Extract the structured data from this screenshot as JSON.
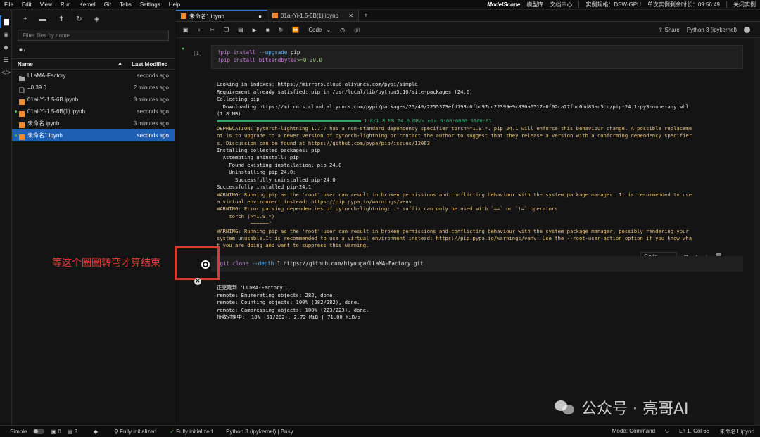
{
  "menu": [
    "File",
    "Edit",
    "View",
    "Run",
    "Kernel",
    "Git",
    "Tabs",
    "Settings",
    "Help"
  ],
  "topright": {
    "brand": "ModelScope",
    "links": [
      "模型库",
      "文档中心"
    ],
    "spec": "实例规格：DSW-GPU",
    "remaining": "单次实例剩余时长：09:56:49",
    "close": "关闭实例"
  },
  "filebrowser": {
    "filter_placeholder": "Filter files by name",
    "path": "■ /",
    "col_name": "Name",
    "col_modified": "Last Modified",
    "rows": [
      {
        "name": "LLaMA-Factory",
        "modified": "seconds ago",
        "icon": "folder-icon"
      },
      {
        "name": "=0.39.0",
        "modified": "2 minutes ago",
        "icon": "file-icon"
      },
      {
        "name": "01ai-Yi-1.5-6B.ipynb",
        "modified": "3 minutes ago",
        "icon": "notebook-icon"
      },
      {
        "name": "01ai-Yi-1.5-6B(1).ipynb",
        "modified": "seconds ago",
        "icon": "notebook-icon"
      },
      {
        "name": "未命名.ipynb",
        "modified": "3 minutes ago",
        "icon": "notebook-icon"
      },
      {
        "name": "未命名1.ipynb",
        "modified": "seconds ago",
        "icon": "notebook-icon"
      }
    ]
  },
  "tabs": [
    {
      "label": "未命名1.ipynb"
    },
    {
      "label": "01ai-Yi-1.5-6B(1).ipynb"
    }
  ],
  "toolbar": {
    "celltype": "Code",
    "share": "Share",
    "kernel": "Python 3 (ipykernel)"
  },
  "cell1": {
    "prompt": "[1]",
    "line1_cmd": "!pip install ",
    "line1_opt": "--upgrade",
    "line1_pkg": " pip",
    "line2_cmd": "!pip install bitsandbytes",
    "line2_ver": ">=0.39.0"
  },
  "out1": {
    "l1": "Looking in indexes: https://mirrors.cloud.aliyuncs.com/pypi/simple",
    "l2": "Requirement already satisfied: pip in /usr/local/lib/python3.10/site-packages (24.0)",
    "l3": "Collecting pip",
    "l4": "  Downloading https://mirrors.cloud.aliyuncs.com/pypi/packages/25/49/2255373efd193c6fbd97dc22399e9c830a6517a0f02ca77fbc0bd83ac5cc/pip-24.1-py3-none-any.whl",
    "l5": "(1.8 MB)",
    "l6": "1.8/1.8 MB 24.0 MB/s eta 0:00:0000:0100:01",
    "w1": "DEPRECATION: pytorch-lightning 1.7.7 has a non-standard dependency specifier torch>=1.9.*. pip 24.1 will enforce this behaviour change. A possible replaceme",
    "w2": "nt is to upgrade to a newer version of pytorch-lightning or contact the author to suggest that they release a version with a conforming dependency specifier",
    "w3": "s. Discussion can be found at https://github.com/pypa/pip/issues/12063",
    "l7": "Installing collected packages: pip",
    "l8": "  Attempting uninstall: pip",
    "l9": "    Found existing installation: pip 24.0",
    "l10": "    Uninstalling pip-24.0:",
    "l11": "      Successfully uninstalled pip-24.0",
    "l12": "Successfully installed pip-24.1",
    "w4": "WARNING: Running pip as the 'root' user can result in broken permissions and conflicting behaviour with the system package manager. It is recommended to use",
    "w5": "a virtual environment instead: https://pip.pypa.io/warnings/venv",
    "w6": "WARNING: Error parsing dependencies of pytorch-lightning: .* suffix can only be used with `==` or `!=` operators",
    "w7": "    torch (>=1.9.*)",
    "w8": "           ~~~~~~^",
    "w9": "WARNING: Running pip as the 'root' user can result in broken permissions and conflicting behaviour with the system package manager, possibly rendering your",
    "w10": "system unusable.It is recommended to use a virtual environment instead: https://pip.pypa.io/warnings/venv. Use the --root-user-action option if you know wha",
    "w11": "t you are doing and want to suppress this warning."
  },
  "cell2": {
    "code_a": "!git clone ",
    "code_b": "--depth",
    "code_c": " 1 https://github.com/hiyouga/LLaMA-Factory.git",
    "celltype": "Code"
  },
  "out2": {
    "l1": "正克隆到 'LLaMA-Factory'...",
    "l2": "remote: Enumerating objects: 282, done.",
    "l3": "remote: Counting objects: 100% (282/282), done.",
    "l4": "remote: Compressing objects: 100% (223/223), done.",
    "l5": "接收对象中:  18% (51/282), 2.72 MiB | 71.00 KiB/s"
  },
  "annotation": "等这个圈圈转弯才算结束",
  "watermark": "公众号 · 亮哥AI",
  "status": {
    "mode": "Simple",
    "n1": "0",
    "n2": "3",
    "init1": "Fully initialized",
    "init2": "Fully initialized",
    "kernel": "Python 3 (ipykernel) | Busy",
    "cmd": "Mode: Command",
    "pos": "Ln 1, Col 66",
    "file": "未命名1.ipynb"
  },
  "colors": {
    "accent": "#2b7be4",
    "selected_row": "#1e5fb4",
    "warning": "#e5c07b",
    "annotation": "#e53935"
  }
}
